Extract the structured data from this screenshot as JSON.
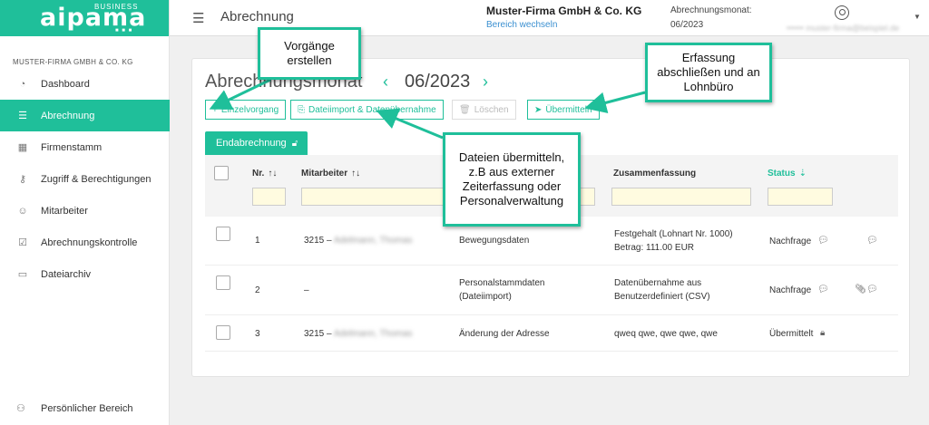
{
  "app": {
    "brand": "aipama",
    "brand_sub": "BUSINESS",
    "brand_dots": "■ ■ ■"
  },
  "sidebar": {
    "company": "MUSTER-FIRMA GMBH & CO. KG",
    "items": [
      {
        "label": "Dashboard",
        "icon": "dashboard-gauge-icon",
        "glyph": "◔"
      },
      {
        "label": "Abrechnung",
        "icon": "list-icon",
        "glyph": "☰"
      },
      {
        "label": "Firmenstamm",
        "icon": "building-icon",
        "glyph": "▦"
      },
      {
        "label": "Zugriff & Berechtigungen",
        "icon": "key-icon",
        "glyph": "⚷"
      },
      {
        "label": "Mitarbeiter",
        "icon": "people-icon",
        "glyph": "☺"
      },
      {
        "label": "Abrechnungskontrolle",
        "icon": "clipboard-check-icon",
        "glyph": "☑"
      },
      {
        "label": "Dateiarchiv",
        "icon": "archive-icon",
        "glyph": "▭"
      }
    ],
    "personal": "Persönlicher Bereich"
  },
  "header": {
    "title": "Abrechnung",
    "company": "Muster-Firma GmbH & Co. KG",
    "switch_link": "Bereich wechseln",
    "month_label": "Abrechnungsmonat:",
    "month_value": "06/2023",
    "user_email": "•••••• muster-firma@beispiel.de"
  },
  "main": {
    "title": "Abrechnungsmonat",
    "month": "06/2023",
    "prev": "‹",
    "next": "›",
    "buttons": {
      "einzel": "Einzelvorgang",
      "import": "Dateiimport & Datenübernahme",
      "loeschen": "Löschen",
      "uebermitteln": "Übermitteln"
    },
    "tab": "Endabrechnung"
  },
  "table": {
    "headers": {
      "nr": "Nr.",
      "mitarbeiter": "Mitarbeiter",
      "zusammenfassung": "Zusammenfassung",
      "status": "Status"
    },
    "rows": [
      {
        "nr": "1",
        "ma_id": "3215 –",
        "ma_name": "Adelmann, Thomas",
        "art": "Bewegungsdaten",
        "sum1": "Festgehalt (Lohnart Nr. 1000)",
        "sum2": "Betrag: 111.00 EUR",
        "status": "Nachfrage"
      },
      {
        "nr": "2",
        "ma_id": "–",
        "ma_name": "",
        "art": "Personalstammdaten",
        "art2": "(Dateiimport)",
        "sum1": "Datenübernahme aus",
        "sum2": "Benutzerdefiniert (CSV)",
        "status": "Nachfrage"
      },
      {
        "nr": "3",
        "ma_id": "3215 –",
        "ma_name": "Adelmann, Thomas",
        "art": "Änderung der Adresse",
        "sum1": "qweq qwe, qwe qwe, qwe",
        "status": "Übermittelt"
      }
    ]
  },
  "callouts": {
    "vorgaenge": "Vorgänge erstellen",
    "erfassung": "Erfassung abschließen und an Lohnbüro",
    "dateien": "Dateien übermitteln, z.B aus externer Zeiterfassung oder Personalverwaltung"
  },
  "colors": {
    "accent": "#1fbf9a",
    "link": "#3a8fd0"
  }
}
